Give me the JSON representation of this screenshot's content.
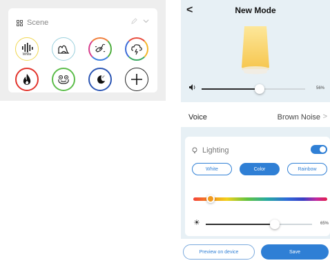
{
  "scene": {
    "header_icon": "grid-icon",
    "title": "Scene",
    "tools": {
      "edit_icon": "pencil-icon",
      "expand_icon": "chevron-down-icon"
    },
    "items": [
      {
        "name": "white-noise",
        "icon": "sound-bars-icon",
        "label": "White",
        "ring": "#f0d64e"
      },
      {
        "name": "mountain",
        "icon": "mountain-icon",
        "label": "",
        "ring": "#9ad0dd"
      },
      {
        "name": "birds",
        "icon": "birds-icon",
        "label": "",
        "ring": "#f07e3a|#4fae3f|#3a7ee0|#d73c8c"
      },
      {
        "name": "thunderstorm",
        "icon": "storm-cloud-icon",
        "label": "",
        "ring": "#e84b3c|#f3b52a|#3aa860|#3a6ad8"
      },
      {
        "name": "fire",
        "icon": "flame-icon",
        "label": "",
        "ring": "#e2332b"
      },
      {
        "name": "frog",
        "icon": "frog-icon",
        "label": "",
        "ring": "#5cbd4a"
      },
      {
        "name": "night",
        "icon": "moon-icon",
        "label": "",
        "ring": "#2b55b3"
      },
      {
        "name": "add",
        "icon": "plus-icon",
        "label": "",
        "ring": "#222222"
      }
    ]
  },
  "phone": {
    "back_icon": "chevron-left-icon",
    "back_glyph": "<",
    "title": "New Mode",
    "lamp_icon": "night-lamp-icon",
    "volume": {
      "icon": "speaker-icon",
      "value": 56,
      "label": "56%"
    },
    "voice": {
      "label": "Voice",
      "value": "Brown Noise",
      "chevron": ">"
    },
    "lighting": {
      "icon": "lightbulb-icon",
      "label": "Lighting",
      "enabled": true,
      "modes": [
        "White",
        "Color",
        "Rainbow"
      ],
      "active_mode": "Color",
      "hue_position": 0.13,
      "brightness": {
        "icon": "sun-icon",
        "value": 65,
        "label": "65%"
      }
    },
    "actions": {
      "preview": "Preview on device",
      "save": "Save"
    }
  },
  "colors": {
    "accent": "#2f7fd5",
    "panel_bg": "#e7f0f5",
    "selected_hue": "#f19a1e"
  }
}
